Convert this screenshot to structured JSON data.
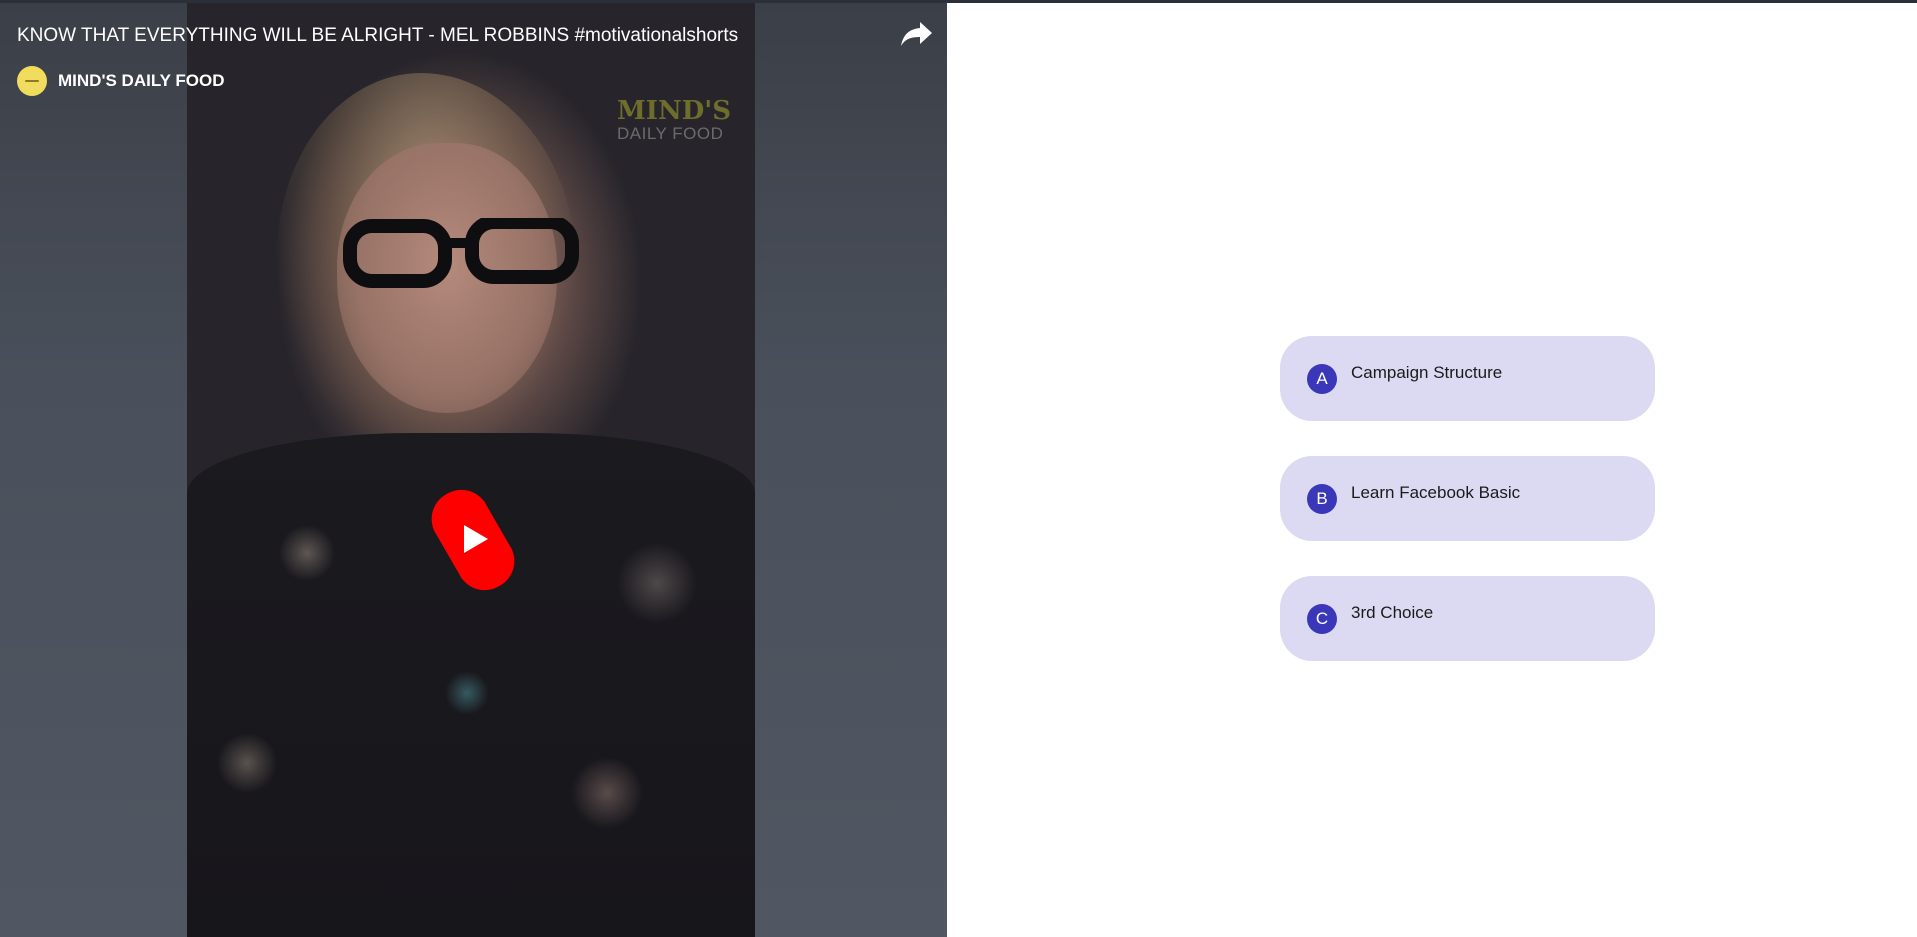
{
  "video": {
    "title": "KNOW THAT EVERYTHING WILL BE ALRIGHT - MEL ROBBINS #motivationalshorts",
    "channel_name": "MIND'S DAILY FOOD",
    "watermark_line1": "MIND'S",
    "watermark_line2": "DAILY FOOD",
    "share_icon": "share-arrow-icon",
    "play_icon": "youtube-shorts-play-icon",
    "colors": {
      "play_red": "#ff0000",
      "avatar_yellow": "#f2dc5d"
    }
  },
  "options": [
    {
      "letter": "A",
      "label": "Campaign Structure"
    },
    {
      "letter": "B",
      "label": "Learn Facebook Basic"
    },
    {
      "letter": "C",
      "label": "3rd Choice"
    }
  ],
  "colors": {
    "option_background": "#dcdaf3",
    "option_badge": "#3a38b8"
  }
}
